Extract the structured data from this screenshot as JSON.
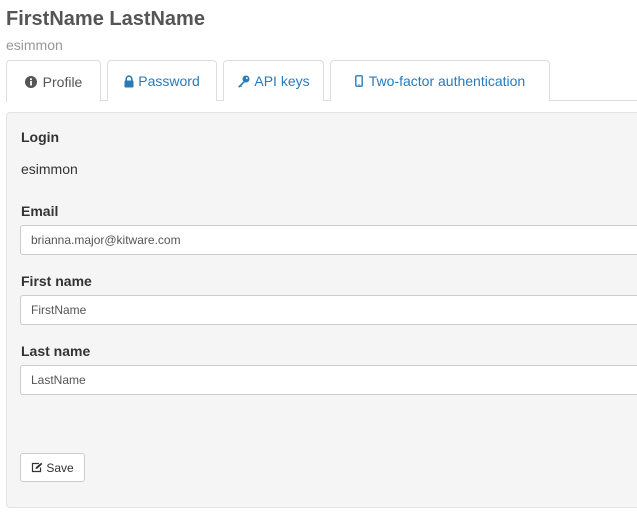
{
  "header": {
    "full_name": "FirstName LastName",
    "login": "esimmon"
  },
  "tabs": [
    {
      "label": "Profile",
      "icon": "info-icon",
      "active": true
    },
    {
      "label": "Password",
      "icon": "lock-icon",
      "active": false
    },
    {
      "label": "API keys",
      "icon": "key-icon",
      "active": false
    },
    {
      "label": "Two-factor authentication",
      "icon": "mobile-icon",
      "active": false
    }
  ],
  "form": {
    "login_label": "Login",
    "login_value": "esimmon",
    "email_label": "Email",
    "email_value": "brianna.major@kitware.com",
    "first_name_label": "First name",
    "first_name_value": "FirstName",
    "last_name_label": "Last name",
    "last_name_value": "LastName",
    "save_label": "Save",
    "save_icon": "edit-icon"
  },
  "colors": {
    "link": "#2a7ab8",
    "panel_bg": "#f5f5f5",
    "border": "#dddddd"
  }
}
